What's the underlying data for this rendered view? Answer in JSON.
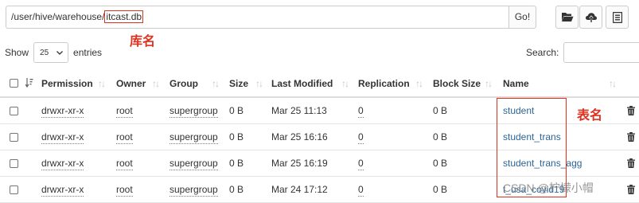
{
  "path_bar": {
    "path_prefix": "/user/hive/warehouse/",
    "path_db": "itcast.db",
    "go_label": "Go!"
  },
  "toolbar": {
    "icons": [
      "folder-open-icon",
      "upload-icon",
      "list-icon"
    ]
  },
  "annotations": {
    "db_label": "库名",
    "table_label": "表名"
  },
  "length_control": {
    "show_label": "Show",
    "page_size": "25",
    "entries_label": "entries"
  },
  "search": {
    "label": "Search:",
    "value": ""
  },
  "table": {
    "columns": [
      "Permission",
      "Owner",
      "Group",
      "Size",
      "Last Modified",
      "Replication",
      "Block Size",
      "Name"
    ],
    "rows": [
      {
        "permission": "drwxr-xr-x",
        "owner": "root",
        "group": "supergroup",
        "size": "0 B",
        "last_modified": "Mar 25 11:13",
        "replication": "0",
        "block_size": "0 B",
        "name": "student"
      },
      {
        "permission": "drwxr-xr-x",
        "owner": "root",
        "group": "supergroup",
        "size": "0 B",
        "last_modified": "Mar 25 16:16",
        "replication": "0",
        "block_size": "0 B",
        "name": "student_trans"
      },
      {
        "permission": "drwxr-xr-x",
        "owner": "root",
        "group": "supergroup",
        "size": "0 B",
        "last_modified": "Mar 25 16:19",
        "replication": "0",
        "block_size": "0 B",
        "name": "student_trans_agg"
      },
      {
        "permission": "drwxr-xr-x",
        "owner": "root",
        "group": "supergroup",
        "size": "0 B",
        "last_modified": "Mar 24 17:12",
        "replication": "0",
        "block_size": "0 B",
        "name": "t_usa_covid19"
      }
    ]
  },
  "watermark": "CSDN @柠檬小帽",
  "colors": {
    "annotation": "#e0301e",
    "link": "#2a6496",
    "sort_icon": "#c6c6c6"
  }
}
